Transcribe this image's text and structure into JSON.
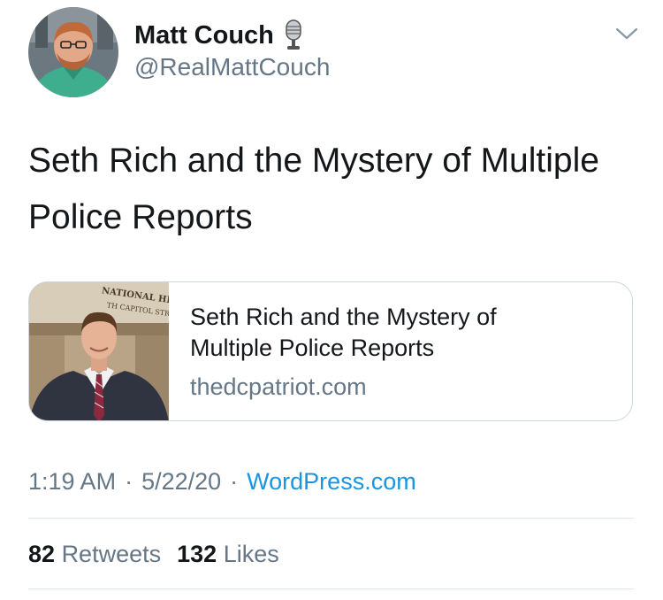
{
  "author": {
    "display_name": "Matt Couch",
    "handle": "@RealMattCouch",
    "avatar_icon": "profile-photo",
    "badge_icon": "microphone-icon"
  },
  "tweet": {
    "text": "Seth Rich and the Mystery of Multiple Police Reports"
  },
  "card": {
    "title": "Seth Rich and the Mystery of Multiple Police Reports",
    "domain": "thedcpatriot.com",
    "image_sign_text": [
      "NATIONAL HEAD",
      "TH CAPITOL STRE"
    ]
  },
  "meta": {
    "time": "1:19 AM",
    "date": "5/22/20",
    "separator": "·",
    "source": "WordPress.com"
  },
  "stats": {
    "retweets_count": "82",
    "retweets_label": "Retweets",
    "likes_count": "132",
    "likes_label": "Likes"
  },
  "colors": {
    "text": "#14171a",
    "secondary": "#657786",
    "link": "#1b95e0",
    "border": "#ccd6dd",
    "divider": "#e1e8ed"
  }
}
